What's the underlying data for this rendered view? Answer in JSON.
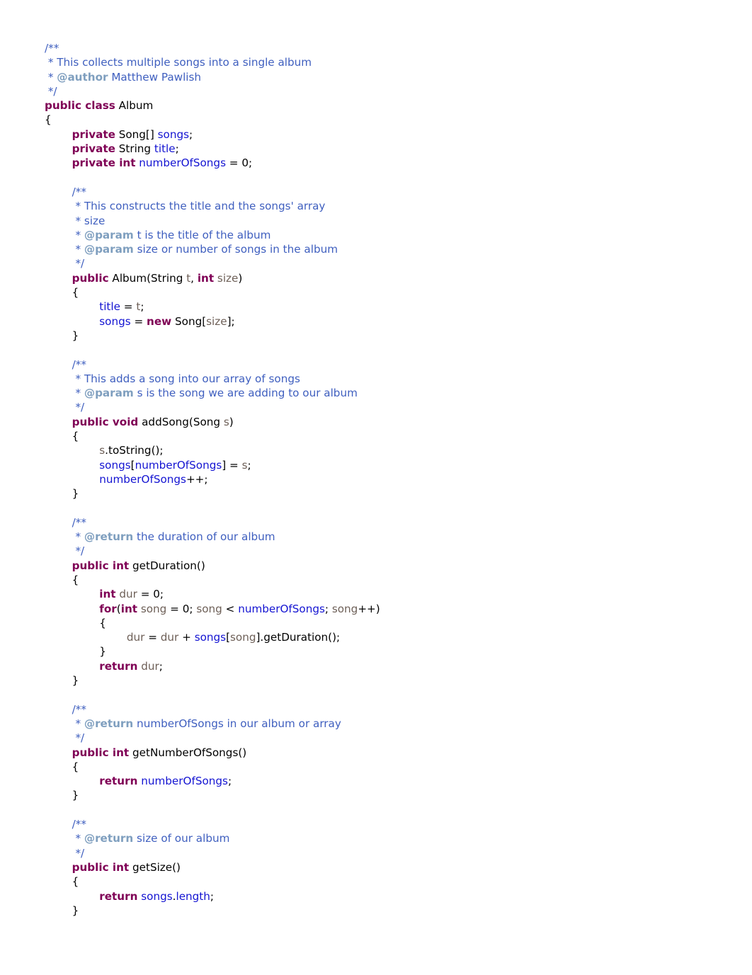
{
  "document": {
    "kind": "source-code-listing",
    "language": "Java",
    "class_name": "Album",
    "author": "Matthew Pawlish",
    "background_color": "#ffffff"
  },
  "colors": {
    "keyword": "#7f0055",
    "field": "#1414d2",
    "local_variable": "#6e6058",
    "comment": "#3f5fbf",
    "javadoc_tag": "#7f9fbf",
    "plain": "#000000"
  },
  "code": {
    "lines": [
      {
        "indent": 0,
        "tokens": [
          {
            "t": "comment",
            "s": "/**"
          }
        ]
      },
      {
        "indent": 0,
        "tokens": [
          {
            "t": "comment",
            "s": " * This collects multiple songs into a single album"
          }
        ]
      },
      {
        "indent": 0,
        "tokens": [
          {
            "t": "comment",
            "s": " * "
          },
          {
            "t": "jdtag",
            "s": "@author"
          },
          {
            "t": "comment",
            "s": " Matthew Pawlish"
          }
        ]
      },
      {
        "indent": 0,
        "tokens": [
          {
            "t": "comment",
            "s": " */"
          }
        ]
      },
      {
        "indent": 0,
        "tokens": [
          {
            "t": "kw",
            "s": "public class"
          },
          {
            "t": "plain",
            "s": " Album"
          }
        ]
      },
      {
        "indent": 0,
        "tokens": [
          {
            "t": "plain",
            "s": "{"
          }
        ]
      },
      {
        "indent": 1,
        "tokens": [
          {
            "t": "kw",
            "s": "private"
          },
          {
            "t": "plain",
            "s": " Song[] "
          },
          {
            "t": "field",
            "s": "songs"
          },
          {
            "t": "plain",
            "s": ";"
          }
        ]
      },
      {
        "indent": 1,
        "tokens": [
          {
            "t": "kw",
            "s": "private"
          },
          {
            "t": "plain",
            "s": " String "
          },
          {
            "t": "field",
            "s": "title"
          },
          {
            "t": "plain",
            "s": ";"
          }
        ]
      },
      {
        "indent": 1,
        "tokens": [
          {
            "t": "kw",
            "s": "private int"
          },
          {
            "t": "plain",
            "s": " "
          },
          {
            "t": "field",
            "s": "numberOfSongs"
          },
          {
            "t": "plain",
            "s": " = 0;"
          }
        ]
      },
      {
        "indent": 0,
        "blank": true,
        "tokens": []
      },
      {
        "indent": 1,
        "tokens": [
          {
            "t": "comment",
            "s": "/**"
          }
        ]
      },
      {
        "indent": 1,
        "tokens": [
          {
            "t": "comment",
            "s": " * This constructs the title and the songs' array"
          }
        ]
      },
      {
        "indent": 1,
        "tokens": [
          {
            "t": "comment",
            "s": " * size"
          }
        ]
      },
      {
        "indent": 1,
        "tokens": [
          {
            "t": "comment",
            "s": " * "
          },
          {
            "t": "jdtag",
            "s": "@param"
          },
          {
            "t": "comment",
            "s": " t is the title of the album"
          }
        ]
      },
      {
        "indent": 1,
        "tokens": [
          {
            "t": "comment",
            "s": " * "
          },
          {
            "t": "jdtag",
            "s": "@param"
          },
          {
            "t": "comment",
            "s": " size or number of songs in the album"
          }
        ]
      },
      {
        "indent": 1,
        "tokens": [
          {
            "t": "comment",
            "s": " */"
          }
        ]
      },
      {
        "indent": 1,
        "tokens": [
          {
            "t": "kw",
            "s": "public"
          },
          {
            "t": "plain",
            "s": " Album(String "
          },
          {
            "t": "local",
            "s": "t"
          },
          {
            "t": "plain",
            "s": ", "
          },
          {
            "t": "kw",
            "s": "int"
          },
          {
            "t": "plain",
            "s": " "
          },
          {
            "t": "local",
            "s": "size"
          },
          {
            "t": "plain",
            "s": ")"
          }
        ]
      },
      {
        "indent": 1,
        "tokens": [
          {
            "t": "plain",
            "s": "{"
          }
        ]
      },
      {
        "indent": 2,
        "tokens": [
          {
            "t": "field",
            "s": "title"
          },
          {
            "t": "plain",
            "s": " = "
          },
          {
            "t": "local",
            "s": "t"
          },
          {
            "t": "plain",
            "s": ";"
          }
        ]
      },
      {
        "indent": 2,
        "tokens": [
          {
            "t": "field",
            "s": "songs"
          },
          {
            "t": "plain",
            "s": " = "
          },
          {
            "t": "kw",
            "s": "new"
          },
          {
            "t": "plain",
            "s": " Song["
          },
          {
            "t": "local",
            "s": "size"
          },
          {
            "t": "plain",
            "s": "];"
          }
        ]
      },
      {
        "indent": 1,
        "tokens": [
          {
            "t": "plain",
            "s": "}"
          }
        ]
      },
      {
        "indent": 0,
        "blank": true,
        "tokens": []
      },
      {
        "indent": 1,
        "tokens": [
          {
            "t": "comment",
            "s": "/**"
          }
        ]
      },
      {
        "indent": 1,
        "tokens": [
          {
            "t": "comment",
            "s": " * This adds a song into our array of songs"
          }
        ]
      },
      {
        "indent": 1,
        "tokens": [
          {
            "t": "comment",
            "s": " * "
          },
          {
            "t": "jdtag",
            "s": "@param"
          },
          {
            "t": "comment",
            "s": " s is the song we are adding to our album"
          }
        ]
      },
      {
        "indent": 1,
        "tokens": [
          {
            "t": "comment",
            "s": " */"
          }
        ]
      },
      {
        "indent": 1,
        "tokens": [
          {
            "t": "kw",
            "s": "public void"
          },
          {
            "t": "plain",
            "s": " addSong(Song "
          },
          {
            "t": "local",
            "s": "s"
          },
          {
            "t": "plain",
            "s": ")"
          }
        ]
      },
      {
        "indent": 1,
        "tokens": [
          {
            "t": "plain",
            "s": "{"
          }
        ]
      },
      {
        "indent": 2,
        "tokens": [
          {
            "t": "local",
            "s": "s"
          },
          {
            "t": "plain",
            "s": ".toString();"
          }
        ]
      },
      {
        "indent": 2,
        "tokens": [
          {
            "t": "field",
            "s": "songs"
          },
          {
            "t": "plain",
            "s": "["
          },
          {
            "t": "field",
            "s": "numberOfSongs"
          },
          {
            "t": "plain",
            "s": "] = "
          },
          {
            "t": "local",
            "s": "s"
          },
          {
            "t": "plain",
            "s": ";"
          }
        ]
      },
      {
        "indent": 2,
        "tokens": [
          {
            "t": "field",
            "s": "numberOfSongs"
          },
          {
            "t": "plain",
            "s": "++;"
          }
        ]
      },
      {
        "indent": 1,
        "tokens": [
          {
            "t": "plain",
            "s": "}"
          }
        ]
      },
      {
        "indent": 0,
        "blank": true,
        "tokens": []
      },
      {
        "indent": 1,
        "tokens": [
          {
            "t": "comment",
            "s": "/**"
          }
        ]
      },
      {
        "indent": 1,
        "tokens": [
          {
            "t": "comment",
            "s": " * "
          },
          {
            "t": "jdtag",
            "s": "@return"
          },
          {
            "t": "comment",
            "s": " the duration of our album"
          }
        ]
      },
      {
        "indent": 1,
        "tokens": [
          {
            "t": "comment",
            "s": " */"
          }
        ]
      },
      {
        "indent": 1,
        "tokens": [
          {
            "t": "kw",
            "s": "public int"
          },
          {
            "t": "plain",
            "s": " getDuration()"
          }
        ]
      },
      {
        "indent": 1,
        "tokens": [
          {
            "t": "plain",
            "s": "{"
          }
        ]
      },
      {
        "indent": 2,
        "tokens": [
          {
            "t": "kw",
            "s": "int"
          },
          {
            "t": "plain",
            "s": " "
          },
          {
            "t": "local",
            "s": "dur"
          },
          {
            "t": "plain",
            "s": " = 0;"
          }
        ]
      },
      {
        "indent": 2,
        "tokens": [
          {
            "t": "kw",
            "s": "for"
          },
          {
            "t": "plain",
            "s": "("
          },
          {
            "t": "kw",
            "s": "int"
          },
          {
            "t": "plain",
            "s": " "
          },
          {
            "t": "local",
            "s": "song"
          },
          {
            "t": "plain",
            "s": " = 0; "
          },
          {
            "t": "local",
            "s": "song"
          },
          {
            "t": "plain",
            "s": " < "
          },
          {
            "t": "field",
            "s": "numberOfSongs"
          },
          {
            "t": "plain",
            "s": "; "
          },
          {
            "t": "local",
            "s": "song"
          },
          {
            "t": "plain",
            "s": "++)"
          }
        ]
      },
      {
        "indent": 2,
        "tokens": [
          {
            "t": "plain",
            "s": "{"
          }
        ]
      },
      {
        "indent": 3,
        "tokens": [
          {
            "t": "local",
            "s": "dur"
          },
          {
            "t": "plain",
            "s": " = "
          },
          {
            "t": "local",
            "s": "dur"
          },
          {
            "t": "plain",
            "s": " + "
          },
          {
            "t": "field",
            "s": "songs"
          },
          {
            "t": "plain",
            "s": "["
          },
          {
            "t": "local",
            "s": "song"
          },
          {
            "t": "plain",
            "s": "].getDuration();"
          }
        ]
      },
      {
        "indent": 2,
        "tokens": [
          {
            "t": "plain",
            "s": "}"
          }
        ]
      },
      {
        "indent": 2,
        "tokens": [
          {
            "t": "kw",
            "s": "return"
          },
          {
            "t": "plain",
            "s": " "
          },
          {
            "t": "local",
            "s": "dur"
          },
          {
            "t": "plain",
            "s": ";"
          }
        ]
      },
      {
        "indent": 1,
        "tokens": [
          {
            "t": "plain",
            "s": "}"
          }
        ]
      },
      {
        "indent": 0,
        "blank": true,
        "tokens": []
      },
      {
        "indent": 1,
        "tokens": [
          {
            "t": "comment",
            "s": "/**"
          }
        ]
      },
      {
        "indent": 1,
        "tokens": [
          {
            "t": "comment",
            "s": " * "
          },
          {
            "t": "jdtag",
            "s": "@return"
          },
          {
            "t": "comment",
            "s": " numberOfSongs in our album or array"
          }
        ]
      },
      {
        "indent": 1,
        "tokens": [
          {
            "t": "comment",
            "s": " */"
          }
        ]
      },
      {
        "indent": 1,
        "tokens": [
          {
            "t": "kw",
            "s": "public int"
          },
          {
            "t": "plain",
            "s": " getNumberOfSongs()"
          }
        ]
      },
      {
        "indent": 1,
        "tokens": [
          {
            "t": "plain",
            "s": "{"
          }
        ]
      },
      {
        "indent": 2,
        "tokens": [
          {
            "t": "kw",
            "s": "return"
          },
          {
            "t": "plain",
            "s": " "
          },
          {
            "t": "field",
            "s": "numberOfSongs"
          },
          {
            "t": "plain",
            "s": ";"
          }
        ]
      },
      {
        "indent": 1,
        "tokens": [
          {
            "t": "plain",
            "s": "}"
          }
        ]
      },
      {
        "indent": 0,
        "blank": true,
        "tokens": []
      },
      {
        "indent": 1,
        "tokens": [
          {
            "t": "comment",
            "s": "/**"
          }
        ]
      },
      {
        "indent": 1,
        "tokens": [
          {
            "t": "comment",
            "s": " * "
          },
          {
            "t": "jdtag",
            "s": "@return"
          },
          {
            "t": "comment",
            "s": " size of our album"
          }
        ]
      },
      {
        "indent": 1,
        "tokens": [
          {
            "t": "comment",
            "s": " */"
          }
        ]
      },
      {
        "indent": 1,
        "tokens": [
          {
            "t": "kw",
            "s": "public int"
          },
          {
            "t": "plain",
            "s": " getSize()"
          }
        ]
      },
      {
        "indent": 1,
        "tokens": [
          {
            "t": "plain",
            "s": "{"
          }
        ]
      },
      {
        "indent": 2,
        "tokens": [
          {
            "t": "kw",
            "s": "return"
          },
          {
            "t": "plain",
            "s": " "
          },
          {
            "t": "field",
            "s": "songs"
          },
          {
            "t": "plain",
            "s": "."
          },
          {
            "t": "field",
            "s": "length"
          },
          {
            "t": "plain",
            "s": ";"
          }
        ]
      },
      {
        "indent": 1,
        "tokens": [
          {
            "t": "plain",
            "s": "}"
          }
        ]
      }
    ]
  }
}
